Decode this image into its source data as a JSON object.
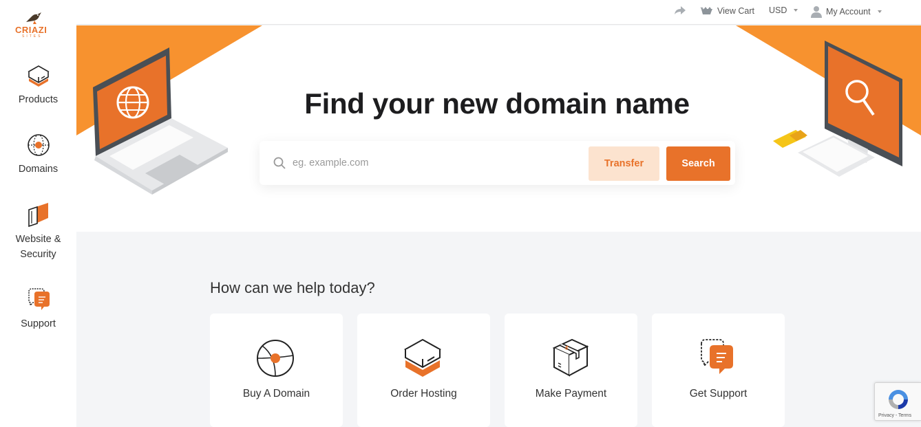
{
  "brand": {
    "name": "CRIAZI",
    "sub": "SITES",
    "color": "#e8722a"
  },
  "sidebar": {
    "items": [
      {
        "label": "Products",
        "icon": "server-box-icon"
      },
      {
        "label": "Domains",
        "icon": "globe-icon"
      },
      {
        "label": "Website &",
        "label2": "Security",
        "icon": "shield-book-icon"
      },
      {
        "label": "Support",
        "icon": "chat-bubbles-icon"
      }
    ]
  },
  "topbar": {
    "share_icon": "share-arrow-icon",
    "cart_label": "View Cart",
    "currency": "USD",
    "account_label": "My Account"
  },
  "hero": {
    "title": "Find your new domain name",
    "search": {
      "placeholder": "eg. example.com",
      "value": "",
      "transfer_label": "Transfer",
      "search_label": "Search"
    }
  },
  "help": {
    "heading": "How can we help today?",
    "cards": [
      {
        "label": "Buy A Domain",
        "icon": "globe-icon"
      },
      {
        "label": "Order Hosting",
        "icon": "server-box-icon"
      },
      {
        "label": "Make Payment",
        "icon": "package-box-icon"
      },
      {
        "label": "Get Support",
        "icon": "chat-bubbles-icon"
      }
    ]
  },
  "recaptcha": {
    "text": "Privacy - Terms"
  },
  "colors": {
    "accent": "#e8722a",
    "accent_light": "#fce3cf",
    "orange_band": "#f7922f",
    "sidebar_bg": "#ffffff",
    "page_bg": "#f4f5f7"
  }
}
